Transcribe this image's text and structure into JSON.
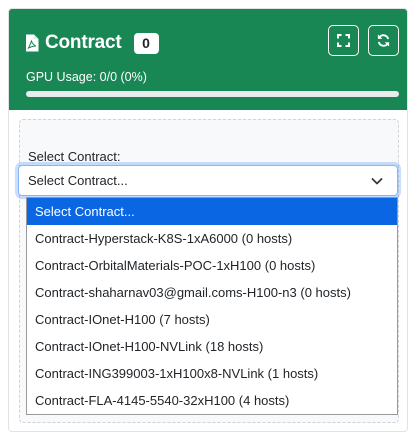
{
  "header": {
    "title": "Contract",
    "count": "0",
    "gpu_usage": "GPU Usage: 0/0 (0%)",
    "gpu_usage_fraction": 0,
    "expand_icon": "fullscreen-icon",
    "refresh_icon": "refresh-icon",
    "file_icon": "pdf-file-icon"
  },
  "colors": {
    "header_bg": "#198754",
    "selected_option_bg": "#0b66e4",
    "focus_border": "#86b7fe"
  },
  "form": {
    "label": "Select Contract:",
    "selected_value": "Select Contract...",
    "options": [
      "Select Contract...",
      "Contract-Hyperstack-K8S-1xA6000 (0 hosts)",
      "Contract-OrbitalMaterials-POC-1xH100 (0 hosts)",
      "Contract-shaharnav03@gmail.coms-H100-n3 (0 hosts)",
      "Contract-IOnet-H100 (7 hosts)",
      "Contract-IOnet-H100-NVLink (18 hosts)",
      "Contract-ING399003-1xH100x8-NVLink (1 hosts)",
      "Contract-FLA-4145-5540-32xH100 (4 hosts)"
    ],
    "highlighted_index": 0
  }
}
